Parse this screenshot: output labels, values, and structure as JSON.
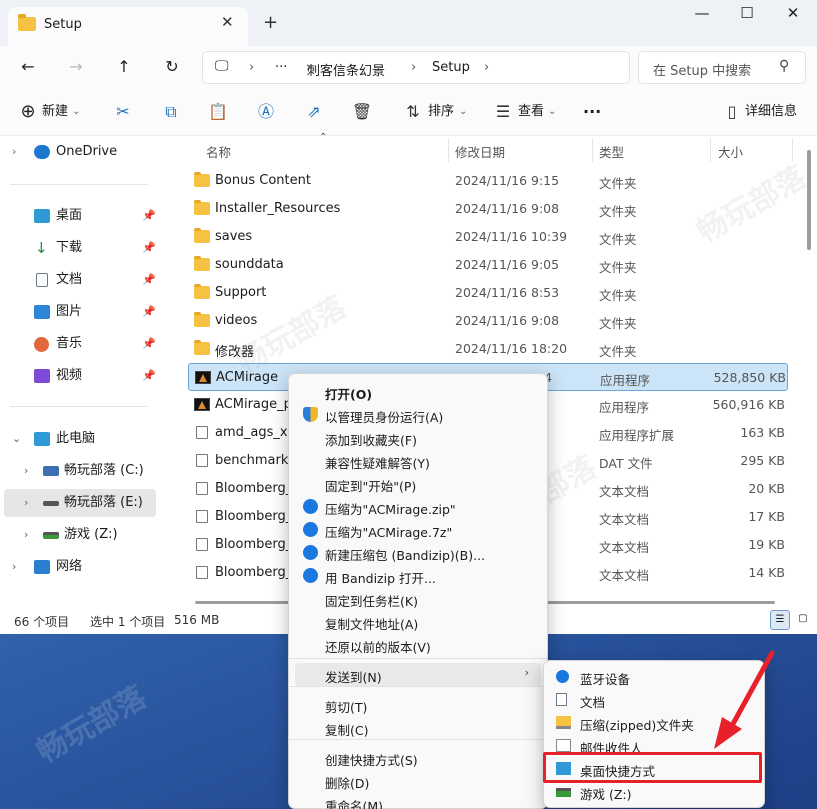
{
  "window": {
    "tab_title": "Setup",
    "tab_close": "✕",
    "new_tab": "+",
    "controls": {
      "minimize": "—",
      "maximize": "☐",
      "close": "✕"
    }
  },
  "nav": {
    "back": "←",
    "forward": "→",
    "up": "↑",
    "refresh": "↻",
    "address": {
      "more": "···",
      "crumb1": "刺客信条幻景",
      "crumb2": "Setup",
      "sep": "›"
    },
    "search_placeholder": "在 Setup 中搜索"
  },
  "toolbar": {
    "new_label": "新建",
    "sort_label": "排序",
    "view_label": "查看",
    "more": "···",
    "details_label": "详细信息"
  },
  "sidebar": {
    "onedrive": "OneDrive",
    "quick": [
      {
        "label": "桌面",
        "icon": "desktop-icon",
        "color": "#2f9ad6"
      },
      {
        "label": "下载",
        "icon": "download-icon",
        "color": "#1a8a3a"
      },
      {
        "label": "文档",
        "icon": "document-icon",
        "color": "#6d7a8a"
      },
      {
        "label": "图片",
        "icon": "picture-icon",
        "color": "#2b86d8"
      },
      {
        "label": "音乐",
        "icon": "music-icon",
        "color": "#e2673c"
      },
      {
        "label": "视频",
        "icon": "video-icon",
        "color": "#7b4ad6"
      }
    ],
    "thispc": "此电脑",
    "drives": [
      {
        "label": "畅玩部落 (C:)"
      },
      {
        "label": "畅玩部落 (E:)"
      },
      {
        "label": "游戏 (Z:)"
      }
    ],
    "network": "网络"
  },
  "columns": {
    "name": "名称",
    "date": "修改日期",
    "type": "类型",
    "size": "大小"
  },
  "files": [
    {
      "name": "Bonus Content",
      "date": "2024/11/16 9:15",
      "type": "文件夹",
      "size": "",
      "kind": "folder"
    },
    {
      "name": "Installer_Resources",
      "date": "2024/11/16 9:08",
      "type": "文件夹",
      "size": "",
      "kind": "folder"
    },
    {
      "name": "saves",
      "date": "2024/11/16 10:39",
      "type": "文件夹",
      "size": "",
      "kind": "folder"
    },
    {
      "name": "sounddata",
      "date": "2024/11/16 9:05",
      "type": "文件夹",
      "size": "",
      "kind": "folder"
    },
    {
      "name": "Support",
      "date": "2024/11/16 8:53",
      "type": "文件夹",
      "size": "",
      "kind": "folder"
    },
    {
      "name": "videos",
      "date": "2024/11/16 9:08",
      "type": "文件夹",
      "size": "",
      "kind": "folder"
    },
    {
      "name": "修改器",
      "date": "2024/11/16 18:20",
      "type": "文件夹",
      "size": "",
      "kind": "folder"
    },
    {
      "name": "ACMirage",
      "date": "2024/11/16 9:4",
      "type": "应用程序",
      "size": "528,850 KB",
      "kind": "app"
    },
    {
      "name": "ACMirage_pl",
      "date": "",
      "type": "应用程序",
      "size": "560,916 KB",
      "kind": "app"
    },
    {
      "name": "amd_ags_x64",
      "date": "",
      "type": "应用程序扩展",
      "size": "163 KB",
      "kind": "doc"
    },
    {
      "name": "benchmark.c",
      "date": "",
      "type": "DAT 文件",
      "size": "295 KB",
      "kind": "doc"
    },
    {
      "name": "Bloomberg_",
      "date": "2",
      "type": "文本文档",
      "size": "20 KB",
      "kind": "doc"
    },
    {
      "name": "Bloomberg_",
      "date": "3",
      "type": "文本文档",
      "size": "17 KB",
      "kind": "doc"
    },
    {
      "name": "Bloomberg_",
      "date": "6",
      "type": "文本文档",
      "size": "19 KB",
      "kind": "doc"
    },
    {
      "name": "Bloomberg_",
      "date": "",
      "type": "文本文档",
      "size": "14 KB",
      "kind": "doc"
    }
  ],
  "status": {
    "count": "66 个项目",
    "selected": "选中 1 个项目",
    "size": "516 MB"
  },
  "context_menu": {
    "items": [
      {
        "label": "打开(O)",
        "bold": true,
        "icon": ""
      },
      {
        "label": "以管理员身份运行(A)",
        "icon": "shield-icon"
      },
      {
        "label": "添加到收藏夹(F)",
        "icon": ""
      },
      {
        "label": "兼容性疑难解答(Y)",
        "icon": ""
      },
      {
        "label": "固定到\"开始\"(P)",
        "icon": ""
      },
      {
        "label": "压缩为\"ACMirage.zip\"",
        "icon": "bandizip-icon"
      },
      {
        "label": "压缩为\"ACMirage.7z\"",
        "icon": "bandizip-icon"
      },
      {
        "label": "新建压缩包 (Bandizip)(B)...",
        "icon": "bandizip-icon"
      },
      {
        "label": "用 Bandizip 打开...",
        "icon": "bandizip-icon"
      },
      {
        "label": "固定到任务栏(K)",
        "icon": ""
      },
      {
        "label": "复制文件地址(A)",
        "icon": ""
      },
      {
        "label": "还原以前的版本(V)",
        "icon": ""
      },
      {
        "label": "发送到(N)",
        "icon": "",
        "submenu": true
      },
      {
        "label": "剪切(T)",
        "icon": ""
      },
      {
        "label": "复制(C)",
        "icon": ""
      },
      {
        "label": "创建快捷方式(S)",
        "icon": ""
      },
      {
        "label": "删除(D)",
        "icon": ""
      },
      {
        "label": "重命名(M)",
        "icon": ""
      }
    ],
    "submenu_arrow": "›"
  },
  "send_to": {
    "items": [
      {
        "label": "蓝牙设备",
        "icon": "bluetooth-icon"
      },
      {
        "label": "文档",
        "icon": "document-icon"
      },
      {
        "label": "压缩(zipped)文件夹",
        "icon": "zip-folder-icon"
      },
      {
        "label": "邮件收件人",
        "icon": "mail-icon"
      },
      {
        "label": "桌面快捷方式",
        "icon": "desktop-icon"
      },
      {
        "label": "游戏 (Z:)",
        "icon": "drive-icon"
      }
    ]
  },
  "colors": {
    "accent": "#0067c0",
    "selection": "#cce4f7",
    "highlight_box": "#e8202a"
  }
}
